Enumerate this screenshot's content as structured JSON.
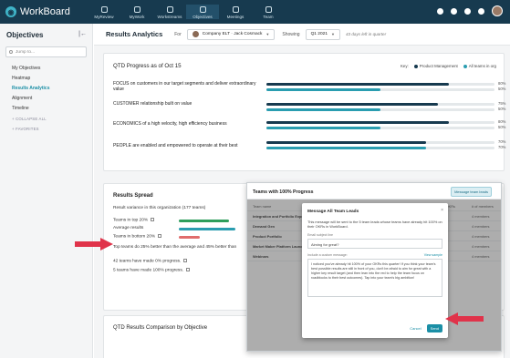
{
  "nav": {
    "logo": "WorkBoard",
    "items": [
      {
        "label": "MyReview"
      },
      {
        "label": "MyWork"
      },
      {
        "label": "Workstreams"
      },
      {
        "label": "Objectives"
      },
      {
        "label": "Meetings"
      },
      {
        "label": "Team"
      }
    ]
  },
  "sidebar": {
    "title": "Objectives",
    "search_placeholder": "Jump to...",
    "items": [
      {
        "label": "My Objectives"
      },
      {
        "label": "Heatmap"
      },
      {
        "label": "Results Analytics"
      },
      {
        "label": "Alignment"
      },
      {
        "label": "Timeline"
      }
    ],
    "sections": [
      {
        "label": "COLLAPSE ALL"
      },
      {
        "label": "FAVORITES"
      }
    ]
  },
  "header": {
    "title": "Results Analytics",
    "for_label": "For",
    "selected_team": "Company ELT · Jack Cosmack",
    "showing_label": "Showing",
    "quarter": "Q1 2021",
    "days_left": "43 days left in quarter"
  },
  "progress_card": {
    "title": "QTD Progress as of Oct 15",
    "key_label": "Key:",
    "legend": [
      {
        "name": "Product Management",
        "color": "#173a4f"
      },
      {
        "name": "All teams in org",
        "color": "#2a9db0"
      }
    ],
    "objectives": [
      {
        "text": "FOCUS on customers in our target segments and deliver extraordinary value",
        "values": [
          80,
          50
        ]
      },
      {
        "text": "CUSTOMER relationship built on value",
        "values": [
          75,
          50
        ]
      },
      {
        "text": "ECONOMICS of a high velocity, high efficiency business",
        "values": [
          80,
          50
        ]
      },
      {
        "text": "PEOPLE are enabled and empowered to operate at their best",
        "values": [
          70,
          70
        ]
      }
    ],
    "pct_labels": [
      "80%",
      "50%",
      "75%",
      "50%",
      "80%",
      "50%",
      "70%",
      "70%"
    ]
  },
  "spread_card": {
    "title": "Results Spread",
    "variance_text": "Result variance in this organization (177 teams)",
    "rows": [
      {
        "label": "Teams in top 20%",
        "color": "#2e9e5b",
        "fill": 0.55
      },
      {
        "label": "Average results",
        "color": "#2a9db0",
        "fill": 0.62
      },
      {
        "label": "Teams in bottom 20%",
        "color": "#e06c6c",
        "fill": 0.23
      }
    ],
    "comparison": "Top teams do 25% better than the average and 45% better than",
    "made_50": "42 teams have made 0% progress.",
    "made_100": "5 teams have made 100% progress."
  },
  "comparison_card": {
    "title": "QTD Results Comparison by Objective"
  },
  "overlay": {
    "title": "Teams with 100% Progress",
    "message_button": "Message team leads",
    "columns": [
      "Team name",
      "Team lead",
      "Reports to",
      "# of OKRs",
      "# of members"
    ],
    "rows": [
      {
        "team": "Integration and Portfolio Expe",
        "members": "4 members"
      },
      {
        "team": "Demand Gen",
        "members": "4 members"
      },
      {
        "team": "Product Portfolio",
        "members": "4 members"
      },
      {
        "team": "Market Maker Platform Launc",
        "members": "4 members"
      },
      {
        "team": "Webinars",
        "members": "4 members"
      }
    ]
  },
  "modal": {
    "title": "Message All Team Leads",
    "close": "×",
    "description": "This message will be sent to the 5 team leads whose teams have already hit 100% on their OKRs in WorkBoard.",
    "subject_label": "Email subject line",
    "subject_value": "Aiming for great?",
    "message_label": "Include a custom message:",
    "view_sample": "View sample",
    "message_value": "I noticed you've already hit 100% of your OKRs this quarter! If you think your team's best possible results are still in front of you, don't be afraid to aim for great with a higher key result target (and then lean into the red to help the team focus on roadblocks to their best outcomes). Tap into your team's big ambition!",
    "cancel": "Cancel",
    "send": "Send"
  },
  "colors": {
    "nav_bg": "#173a4f",
    "accent": "#1b8fa6",
    "arrow": "#e0334a"
  }
}
